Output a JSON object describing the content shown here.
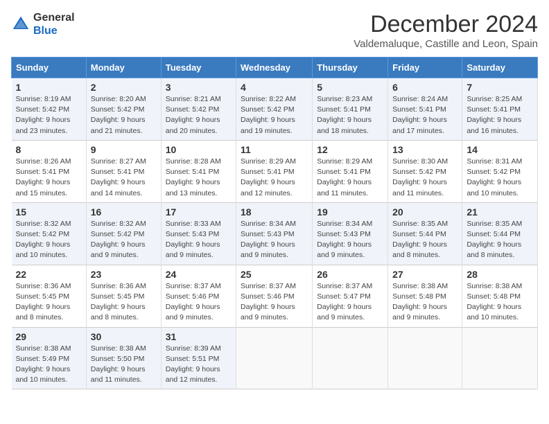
{
  "header": {
    "logo_general": "General",
    "logo_blue": "Blue",
    "month_title": "December 2024",
    "location": "Valdemaluque, Castille and Leon, Spain"
  },
  "weekdays": [
    "Sunday",
    "Monday",
    "Tuesday",
    "Wednesday",
    "Thursday",
    "Friday",
    "Saturday"
  ],
  "weeks": [
    [
      {
        "day": "1",
        "info": "Sunrise: 8:19 AM\nSunset: 5:42 PM\nDaylight: 9 hours and 23 minutes."
      },
      {
        "day": "2",
        "info": "Sunrise: 8:20 AM\nSunset: 5:42 PM\nDaylight: 9 hours and 21 minutes."
      },
      {
        "day": "3",
        "info": "Sunrise: 8:21 AM\nSunset: 5:42 PM\nDaylight: 9 hours and 20 minutes."
      },
      {
        "day": "4",
        "info": "Sunrise: 8:22 AM\nSunset: 5:42 PM\nDaylight: 9 hours and 19 minutes."
      },
      {
        "day": "5",
        "info": "Sunrise: 8:23 AM\nSunset: 5:41 PM\nDaylight: 9 hours and 18 minutes."
      },
      {
        "day": "6",
        "info": "Sunrise: 8:24 AM\nSunset: 5:41 PM\nDaylight: 9 hours and 17 minutes."
      },
      {
        "day": "7",
        "info": "Sunrise: 8:25 AM\nSunset: 5:41 PM\nDaylight: 9 hours and 16 minutes."
      }
    ],
    [
      {
        "day": "8",
        "info": "Sunrise: 8:26 AM\nSunset: 5:41 PM\nDaylight: 9 hours and 15 minutes."
      },
      {
        "day": "9",
        "info": "Sunrise: 8:27 AM\nSunset: 5:41 PM\nDaylight: 9 hours and 14 minutes."
      },
      {
        "day": "10",
        "info": "Sunrise: 8:28 AM\nSunset: 5:41 PM\nDaylight: 9 hours and 13 minutes."
      },
      {
        "day": "11",
        "info": "Sunrise: 8:29 AM\nSunset: 5:41 PM\nDaylight: 9 hours and 12 minutes."
      },
      {
        "day": "12",
        "info": "Sunrise: 8:29 AM\nSunset: 5:41 PM\nDaylight: 9 hours and 11 minutes."
      },
      {
        "day": "13",
        "info": "Sunrise: 8:30 AM\nSunset: 5:42 PM\nDaylight: 9 hours and 11 minutes."
      },
      {
        "day": "14",
        "info": "Sunrise: 8:31 AM\nSunset: 5:42 PM\nDaylight: 9 hours and 10 minutes."
      }
    ],
    [
      {
        "day": "15",
        "info": "Sunrise: 8:32 AM\nSunset: 5:42 PM\nDaylight: 9 hours and 10 minutes."
      },
      {
        "day": "16",
        "info": "Sunrise: 8:32 AM\nSunset: 5:42 PM\nDaylight: 9 hours and 9 minutes."
      },
      {
        "day": "17",
        "info": "Sunrise: 8:33 AM\nSunset: 5:43 PM\nDaylight: 9 hours and 9 minutes."
      },
      {
        "day": "18",
        "info": "Sunrise: 8:34 AM\nSunset: 5:43 PM\nDaylight: 9 hours and 9 minutes."
      },
      {
        "day": "19",
        "info": "Sunrise: 8:34 AM\nSunset: 5:43 PM\nDaylight: 9 hours and 9 minutes."
      },
      {
        "day": "20",
        "info": "Sunrise: 8:35 AM\nSunset: 5:44 PM\nDaylight: 9 hours and 8 minutes."
      },
      {
        "day": "21",
        "info": "Sunrise: 8:35 AM\nSunset: 5:44 PM\nDaylight: 9 hours and 8 minutes."
      }
    ],
    [
      {
        "day": "22",
        "info": "Sunrise: 8:36 AM\nSunset: 5:45 PM\nDaylight: 9 hours and 8 minutes."
      },
      {
        "day": "23",
        "info": "Sunrise: 8:36 AM\nSunset: 5:45 PM\nDaylight: 9 hours and 8 minutes."
      },
      {
        "day": "24",
        "info": "Sunrise: 8:37 AM\nSunset: 5:46 PM\nDaylight: 9 hours and 9 minutes."
      },
      {
        "day": "25",
        "info": "Sunrise: 8:37 AM\nSunset: 5:46 PM\nDaylight: 9 hours and 9 minutes."
      },
      {
        "day": "26",
        "info": "Sunrise: 8:37 AM\nSunset: 5:47 PM\nDaylight: 9 hours and 9 minutes."
      },
      {
        "day": "27",
        "info": "Sunrise: 8:38 AM\nSunset: 5:48 PM\nDaylight: 9 hours and 9 minutes."
      },
      {
        "day": "28",
        "info": "Sunrise: 8:38 AM\nSunset: 5:48 PM\nDaylight: 9 hours and 10 minutes."
      }
    ],
    [
      {
        "day": "29",
        "info": "Sunrise: 8:38 AM\nSunset: 5:49 PM\nDaylight: 9 hours and 10 minutes."
      },
      {
        "day": "30",
        "info": "Sunrise: 8:38 AM\nSunset: 5:50 PM\nDaylight: 9 hours and 11 minutes."
      },
      {
        "day": "31",
        "info": "Sunrise: 8:39 AM\nSunset: 5:51 PM\nDaylight: 9 hours and 12 minutes."
      },
      null,
      null,
      null,
      null
    ]
  ]
}
